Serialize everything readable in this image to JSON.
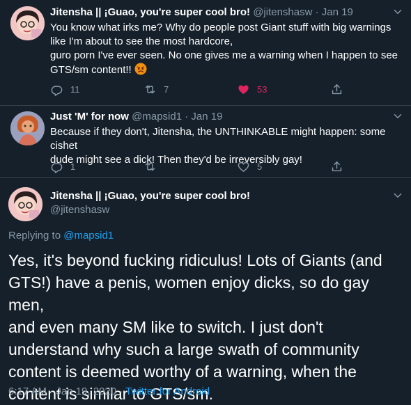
{
  "tweets": [
    {
      "name": "Jitensha || ¡Guao, you're super cool bro!",
      "handle": "@jitenshasw",
      "sep": "·",
      "date": "Jan 19",
      "lines": [
        "You know what irks me? Why do people post Giant stuff with big warnings",
        "like I'm about to see the most hardcore,",
        "guro porn I've ever seen. No one gives me a warning when I happen to see",
        "GTS/sm content!!"
      ],
      "emoji": "angry-face-emoji",
      "replies": "11",
      "retweets": "7",
      "likes": "53"
    },
    {
      "name": "Just 'M' for now",
      "handle": "@mapsid1",
      "sep": "·",
      "date": "Jan 19",
      "lines": [
        "Because if they don't, Jitensha, the UNTHINKABLE might happen: some cishet",
        "dude might see a dick! Then they'd be irreversibly gay!"
      ],
      "replies": "1",
      "retweets": "",
      "likes": "5"
    }
  ],
  "main": {
    "name": "Jitensha || ¡Guao, you're super cool bro!",
    "handle": "@jitenshasw",
    "replying_prefix": "Replying to ",
    "replying_to": "@mapsid1",
    "lines": [
      "Yes, it's beyond fucking ridiculus! Lots of Giants (and",
      "GTS!) have a penis, women enjoy dicks, so do gay men,",
      "and even many SM like to switch. I just don't",
      "understand why such a large swath of community",
      "content is deemed worthy of a warning, when the",
      "content is similar to GTS/sm."
    ],
    "timestamp": "6:17 AM · Jan 19, 2020 · ",
    "source": "Twitter for Android"
  },
  "colors": {
    "background": "#15202b",
    "muted": "#8899a6",
    "accent": "#1da1f2",
    "like": "#e0245e",
    "border": "#38444d"
  },
  "icons": [
    "reply-icon",
    "retweet-icon",
    "like-icon",
    "share-icon",
    "chevron-down-icon"
  ]
}
